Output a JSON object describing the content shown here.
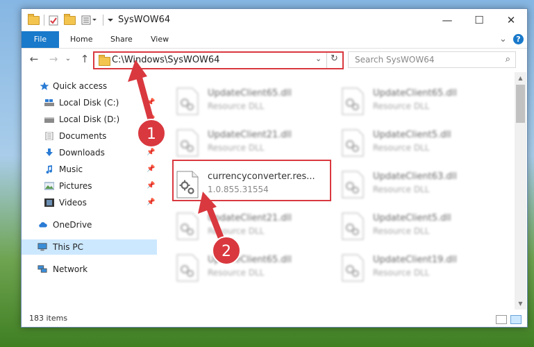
{
  "window": {
    "title": "SysWOW64",
    "controls": {
      "minimize": "—",
      "maximize": "☐",
      "close": "✕"
    }
  },
  "ribbon": {
    "tabs": [
      "File",
      "Home",
      "Share",
      "View"
    ],
    "collapse_glyph": "⌄",
    "help_glyph": "?"
  },
  "nav": {
    "back": "←",
    "forward": "→",
    "recent": "⌄",
    "up": "↑",
    "address": "C:\\Windows\\SysWOW64",
    "address_dropdown": "⌄",
    "refresh": "↻",
    "search_placeholder": "Search SysWOW64",
    "search_icon": "⌕"
  },
  "sidebar": {
    "pin_glyph": "📌",
    "items": [
      {
        "label": "Quick access",
        "icon": "star-icon"
      },
      {
        "label": "Local Disk (C:)",
        "icon": "drive-icon",
        "pinned": true
      },
      {
        "label": "Local Disk (D:)",
        "icon": "drive-icon",
        "pinned": true
      },
      {
        "label": "Documents",
        "icon": "documents-icon",
        "pinned": true
      },
      {
        "label": "Downloads",
        "icon": "download-icon",
        "pinned": true
      },
      {
        "label": "Music",
        "icon": "music-icon",
        "pinned": true
      },
      {
        "label": "Pictures",
        "icon": "pictures-icon",
        "pinned": true
      },
      {
        "label": "Videos",
        "icon": "videos-icon",
        "pinned": true
      },
      {
        "label": "OneDrive",
        "icon": "cloud-icon"
      },
      {
        "label": "This PC",
        "icon": "computer-icon",
        "selected": true
      },
      {
        "label": "Network",
        "icon": "network-icon"
      }
    ]
  },
  "files": [
    {
      "name": "UpdateClient65.dll",
      "type": "Resource DLL"
    },
    {
      "name": "UpdateClient65.dll",
      "type": "Resource DLL"
    },
    {
      "name": "UpdateClient21.dll",
      "type": "Resource DLL"
    },
    {
      "name": "UpdateClient5.dll",
      "type": "Resource DLL"
    },
    {
      "name": "currencyconverter.res...",
      "type": "1.0.855.31554"
    },
    {
      "name": "UpdateClient63.dll",
      "type": "Resource DLL"
    },
    {
      "name": "UpdateClient21.dll",
      "type": "Resource DLL"
    },
    {
      "name": "UpdateClient5.dll",
      "type": "Resource DLL"
    },
    {
      "name": "UpdateClient65.dll",
      "type": "Resource DLL"
    },
    {
      "name": "UpdateClient19.dll",
      "type": "Resource DLL"
    }
  ],
  "status": {
    "item_count": "183 items"
  },
  "annotations": {
    "step1": "1",
    "step2": "2"
  },
  "colors": {
    "accent": "#1979ca",
    "highlight": "#d9383f",
    "selected": "#cce8ff"
  }
}
